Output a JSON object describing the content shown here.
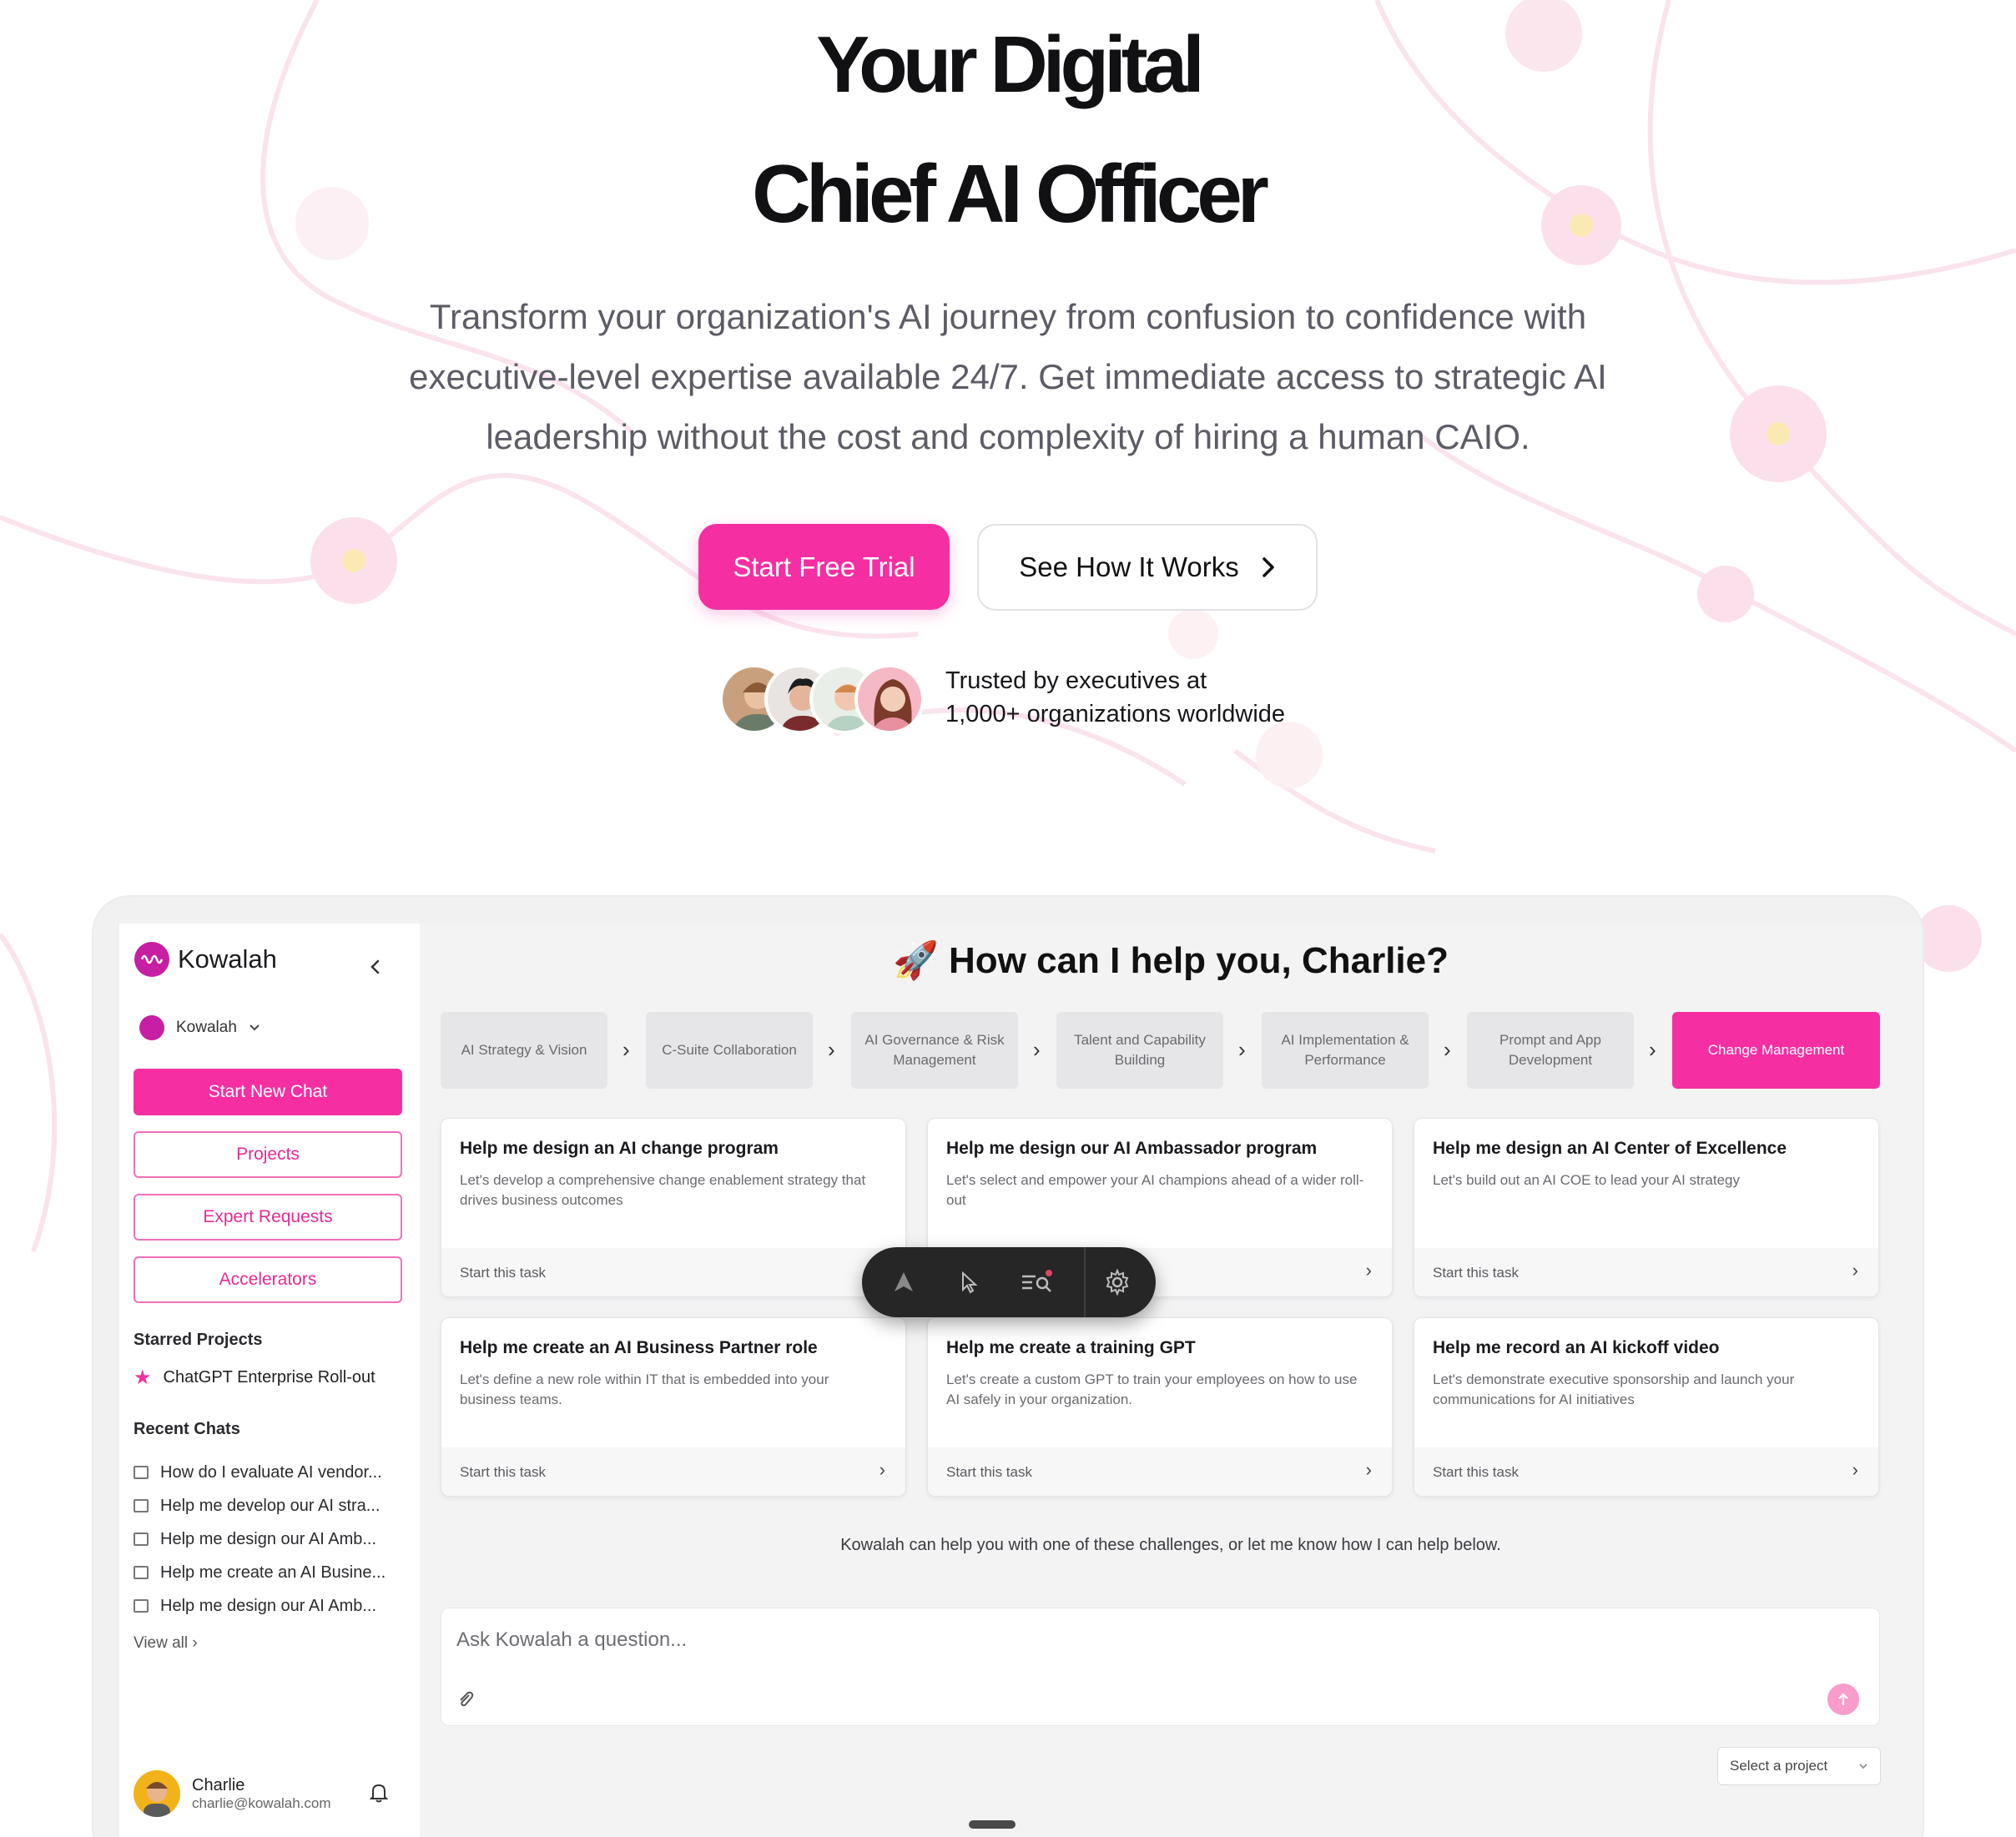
{
  "hero": {
    "title_line1": "Your Digital",
    "title_line2": "Chief AI Officer",
    "subtitle": "Transform your organization's AI journey from confusion to confidence with executive-level expertise available 24/7. Get immediate access to strategic AI leadership without the cost and complexity of hiring a human CAIO.",
    "primary_cta": "Start Free Trial",
    "secondary_cta": "See How It Works",
    "trust_line1": "Trusted by executives at",
    "trust_line2": "1,000+ organizations worldwide"
  },
  "sidebar": {
    "logo_text": "Kowalah",
    "workspace": "Kowalah",
    "start_new_chat": "Start New Chat",
    "projects": "Projects",
    "expert_requests": "Expert Requests",
    "accelerators": "Accelerators",
    "starred_heading": "Starred Projects",
    "starred_item": "ChatGPT Enterprise Roll-out",
    "recent_heading": "Recent Chats",
    "recent_chats": [
      "How do I evaluate AI vendor...",
      "Help me develop our AI stra...",
      "Help me design our AI Amb...",
      "Help me create an AI Busine...",
      "Help me design our AI Amb..."
    ],
    "view_all": "View all",
    "user_name": "Charlie",
    "user_email": "charlie@kowalah.com"
  },
  "main": {
    "greeting": "🚀 How can I help you, Charlie?",
    "tabs": [
      "AI Strategy & Vision",
      "C-Suite Collaboration",
      "AI Governance & Risk Management",
      "Talent and Capability Building",
      "AI Implementation & Performance",
      "Prompt and App Development",
      "Change Management"
    ],
    "active_tab": "Change Management",
    "cards": [
      {
        "title": "Help me design an AI change program",
        "desc": "Let's develop a comprehensive change enablement strategy that drives business outcomes",
        "link": "Start this task"
      },
      {
        "title": "Help me design our AI Ambassador program",
        "desc": "Let's select and empower your AI champions ahead of a wider roll-out",
        "link": ""
      },
      {
        "title": "Help me design an AI Center of Excellence",
        "desc": "Let's build out an AI COE to lead your AI strategy",
        "link": "Start this task"
      },
      {
        "title": "Help me create an AI Business Partner role",
        "desc": "Let's define a new role within IT that is embedded into your business teams.",
        "link": "Start this task"
      },
      {
        "title": "Help me create a training GPT",
        "desc": "Let's create a custom GPT to train your employees on how to use AI safely in your organization.",
        "link": "Start this task"
      },
      {
        "title": "Help me record an AI kickoff video",
        "desc": "Let's demonstrate executive sponsorship and launch your communications for AI initiatives",
        "link": "Start this task"
      }
    ],
    "hint": "Kowalah can help you with one of these challenges, or let me know how I can help below.",
    "ask_placeholder": "Ask Kowalah a question...",
    "select_project": "Select a project"
  },
  "colors": {
    "accent": "#f52fa2",
    "text_dark": "#111114",
    "muted": "#5c5c66"
  },
  "icons": [
    "chevron-right-icon",
    "chevron-left-icon",
    "chevron-down-icon",
    "star-icon",
    "chat-icon",
    "bell-icon",
    "paperclip-icon",
    "send-arrow-icon",
    "gear-icon",
    "cursor-icon",
    "search-list-icon",
    "brand-icon"
  ]
}
